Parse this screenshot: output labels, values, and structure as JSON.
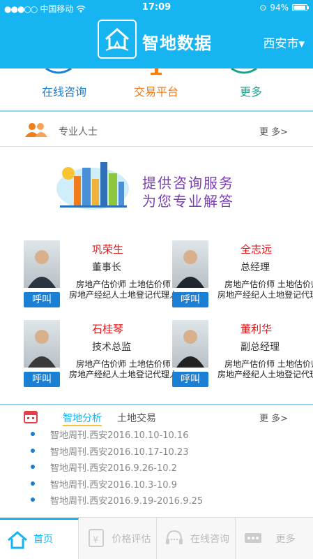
{
  "status_bar": {
    "carrier": "中国移动",
    "time": "17:09",
    "battery": "94%"
  },
  "header": {
    "title": "智地数据",
    "city": "西安市▾"
  },
  "quick_nav": [
    {
      "label": "在线咨询",
      "color": "#1b7fd3"
    },
    {
      "label": "交易平台",
      "color": "#f07c1a"
    },
    {
      "label": "更多",
      "color": "#1aa38a"
    }
  ],
  "professionals": {
    "label": "专业人士",
    "more": "更 多>",
    "banner_line1": "提供咨询服务",
    "banner_line2": "为您专业解答",
    "call_label": "呼叫",
    "experts": [
      {
        "name": "巩荣生",
        "title": "董事长",
        "desc": "房地产估价师 土地估价师　房地产经纪人土地登记代理人"
      },
      {
        "name": "全志远",
        "title": "总经理",
        "desc": "房地产估价师 土地估价师　房地产经纪人土地登记代理人"
      },
      {
        "name": "石桂琴",
        "title": "技术总监",
        "desc": "房地产估价师 土地估价师　房地产经纪人土地登记代理人"
      },
      {
        "name": "董利华",
        "title": "副总经理",
        "desc": "房地产估价师 土地估价师　房地产经纪人土地登记代理人"
      }
    ]
  },
  "news": {
    "tabs": [
      "智地分析",
      "土地交易"
    ],
    "more": "更 多>",
    "items": [
      "智地周刊.西安2016.10.10-10.16",
      "智地周刊.西安2016.10.17-10.23",
      "智地周刊.西安2016.9.26-10.2",
      "智地周刊.西安2016.10.3-10.9",
      "智地周刊.西安2016.9.19-2016.9.25"
    ]
  },
  "tabbar": [
    {
      "label": "首页",
      "icon": "home-icon",
      "active": true
    },
    {
      "label": "价格评估",
      "icon": "calculator-icon",
      "active": false
    },
    {
      "label": "在线咨询",
      "icon": "headset-icon",
      "active": false
    },
    {
      "label": "更多",
      "icon": "more-icon",
      "active": false
    }
  ],
  "colors": {
    "brand": "#16b4f0",
    "accent_red": "#e0161a",
    "button_blue": "#1b7fd3"
  }
}
